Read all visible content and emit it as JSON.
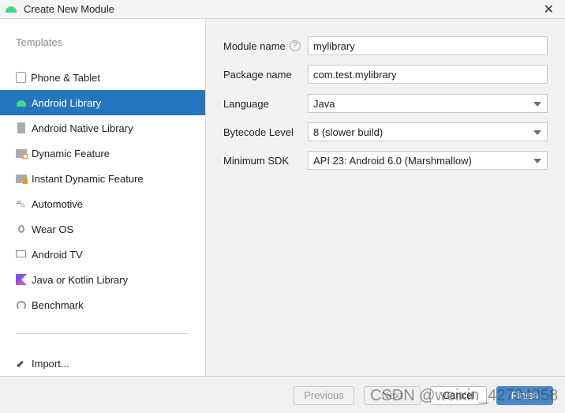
{
  "window": {
    "title": "Create New Module",
    "close_icon": "close-icon"
  },
  "sidebar": {
    "section_label": "Templates",
    "items": [
      {
        "label": "Phone & Tablet",
        "icon": "phone-tablet-icon"
      },
      {
        "label": "Android Library",
        "icon": "android-icon",
        "selected": true
      },
      {
        "label": "Android Native Library",
        "icon": "chip-icon"
      },
      {
        "label": "Dynamic Feature",
        "icon": "folder-icon"
      },
      {
        "label": "Instant Dynamic Feature",
        "icon": "folder-bolt-icon"
      },
      {
        "label": "Automotive",
        "icon": "car-icon"
      },
      {
        "label": "Wear OS",
        "icon": "watch-icon"
      },
      {
        "label": "Android TV",
        "icon": "tv-icon"
      },
      {
        "label": "Java or Kotlin Library",
        "icon": "kotlin-icon"
      },
      {
        "label": "Benchmark",
        "icon": "gauge-icon"
      }
    ],
    "import_label": "Import..."
  },
  "form": {
    "module_name": {
      "label": "Module name",
      "value": "mylibrary"
    },
    "package_name": {
      "label": "Package name",
      "value": "com.test.mylibrary"
    },
    "language": {
      "label": "Language",
      "value": "Java"
    },
    "bytecode": {
      "label": "Bytecode Level",
      "value": "8 (slower build)"
    },
    "min_sdk": {
      "label": "Minimum SDK",
      "value": "API 23: Android 6.0 (Marshmallow)"
    }
  },
  "buttons": {
    "previous": "Previous",
    "next": "Next",
    "cancel": "Cancel",
    "finish": "Finish"
  },
  "watermark": "CSDN @weixin_42794858",
  "colors": {
    "accent": "#2675bf",
    "android_green": "#3ddc84",
    "finish": "#4a88c7"
  }
}
